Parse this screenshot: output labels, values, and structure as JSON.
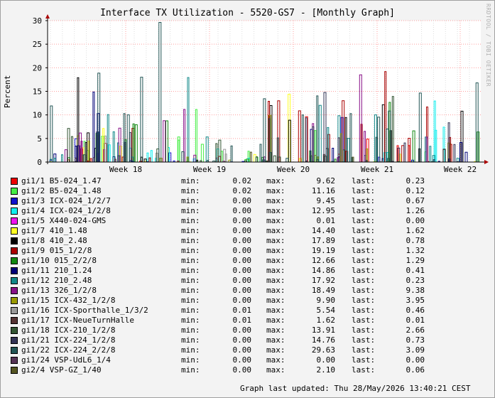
{
  "title": "Interface TX Utilization - 5520-GS7 - [Monthly Graph]",
  "ylabel": "Percent",
  "watermark": "RRDTOOL / TOBI OETIKER",
  "footer": "Graph last updated: Thu 28/May/2026 13:40:21 CEST",
  "legend_labels": {
    "min": "min:",
    "max": "max:",
    "last": "last:"
  },
  "chart_data": {
    "type": "bar",
    "xlabel": "",
    "ylabel": "Percent",
    "ylim": [
      0,
      30
    ],
    "yticks": [
      0,
      5,
      10,
      15,
      20,
      25,
      30
    ],
    "x_ticks": [
      "Week 18",
      "Week 19",
      "Week 20",
      "Week 21",
      "Week 22"
    ],
    "grid": true,
    "legend_position": "bottom",
    "series": [
      {
        "name": "gi1/1 B5-024_1.47",
        "color": "#ee0000",
        "min": "0.02",
        "max": "9.62",
        "last": "0.23"
      },
      {
        "name": "gi1/2 B5-024_1.48",
        "color": "#44ee44",
        "min": "0.02",
        "max": "11.16",
        "last": "0.12"
      },
      {
        "name": "gi1/3 ICX-024_1/2/7",
        "color": "#1111cc",
        "min": "0.00",
        "max": "9.45",
        "last": "0.67"
      },
      {
        "name": "gi1/4 ICX-024_1/2/8",
        "color": "#11eeee",
        "min": "0.00",
        "max": "12.95",
        "last": "1.26"
      },
      {
        "name": "gi1/5 X440-024-GMS",
        "color": "#ee11ee",
        "min": "0.00",
        "max": "0.01",
        "last": "0.00"
      },
      {
        "name": "gi1/7 410_1.48",
        "color": "#ffff22",
        "min": "0.00",
        "max": "14.40",
        "last": "1.62"
      },
      {
        "name": "gi1/8 410_2.48",
        "color": "#000000",
        "min": "0.00",
        "max": "17.89",
        "last": "0.78"
      },
      {
        "name": "gi1/9 015_1/2/8",
        "color": "#aa0000",
        "min": "0.00",
        "max": "19.19",
        "last": "1.32"
      },
      {
        "name": "gi1/10 015_2/2/8",
        "color": "#118811",
        "min": "0.00",
        "max": "12.66",
        "last": "1.29"
      },
      {
        "name": "gi1/11 210_1.24",
        "color": "#000077",
        "min": "0.00",
        "max": "14.86",
        "last": "0.41"
      },
      {
        "name": "gi1/12 210_2.48",
        "color": "#118888",
        "min": "0.00",
        "max": "17.92",
        "last": "0.23"
      },
      {
        "name": "gi1/13 326_1/2/8",
        "color": "#881188",
        "min": "0.00",
        "max": "18.49",
        "last": "9.38"
      },
      {
        "name": "gi1/15 ICX-432_1/2/8",
        "color": "#999900",
        "min": "0.00",
        "max": "9.90",
        "last": "3.95"
      },
      {
        "name": "gi1/16 ICX-Sporthalle_1/3/2",
        "color": "#999999",
        "min": "0.01",
        "max": "5.54",
        "last": "0.46"
      },
      {
        "name": "gi1/17 ICX-NeueTurnHalle",
        "color": "#553333",
        "min": "0.01",
        "max": "1.62",
        "last": "0.01"
      },
      {
        "name": "gi1/18 ICX-210_1/2/8",
        "color": "#335533",
        "min": "0.00",
        "max": "13.91",
        "last": "2.66"
      },
      {
        "name": "gi1/21 ICX-224_1/2/8",
        "color": "#333355",
        "min": "0.00",
        "max": "14.76",
        "last": "0.73"
      },
      {
        "name": "gi1/22 ICX-224_2/2/8",
        "color": "#225555",
        "min": "0.00",
        "max": "29.63",
        "last": "3.09"
      },
      {
        "name": "gi1/24 VSP-UdL6_1/4",
        "color": "#553355",
        "min": "0.00",
        "max": "0.00",
        "last": "0.00"
      },
      {
        "name": "gi2/4 VSP-GZ_1/40",
        "color": "#555522",
        "min": "0.00",
        "max": "2.10",
        "last": "0.06"
      }
    ]
  }
}
